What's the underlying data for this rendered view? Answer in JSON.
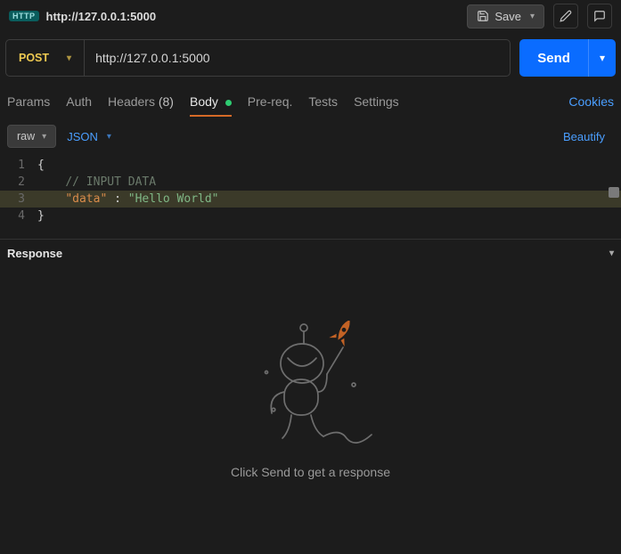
{
  "header": {
    "badge": "HTTP",
    "title": "http://127.0.0.1:5000",
    "save": "Save"
  },
  "request": {
    "method": "POST",
    "url": "http://127.0.0.1:5000",
    "send": "Send"
  },
  "tabs": {
    "params": "Params",
    "auth": "Auth",
    "headers": "Headers",
    "headers_count": "(8)",
    "body": "Body",
    "prereq": "Pre-req.",
    "tests": "Tests",
    "settings": "Settings",
    "cookies": "Cookies"
  },
  "subbar": {
    "raw": "raw",
    "format": "JSON",
    "beautify": "Beautify"
  },
  "editor": {
    "lines": [
      "1",
      "2",
      "3",
      "4"
    ],
    "l1_brace": "{",
    "l2_comment": "// INPUT DATA",
    "l3_key": "\"data\"",
    "l3_colon": " : ",
    "l3_str": "\"Hello World\"",
    "l4_brace": "}"
  },
  "response": {
    "title": "Response",
    "placeholder": "Click Send to get a response"
  }
}
